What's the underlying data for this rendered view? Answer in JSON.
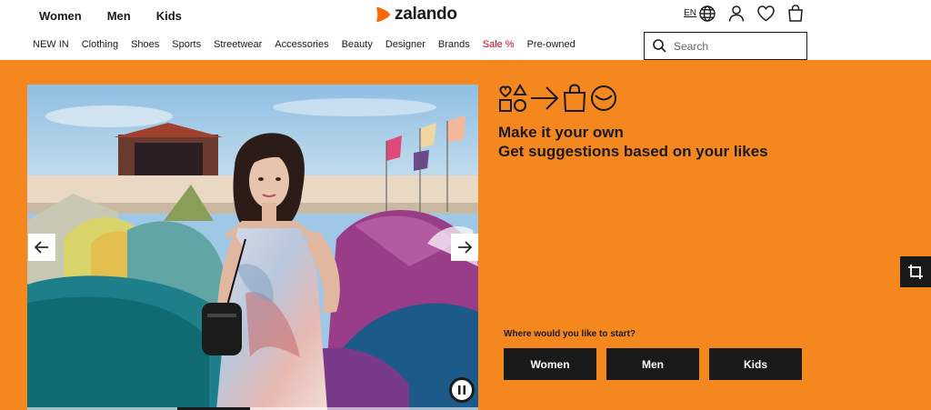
{
  "header": {
    "gender_nav": [
      "Women",
      "Men",
      "Kids"
    ],
    "logo_text": "zalando",
    "language": "EN",
    "icons": [
      "globe-icon",
      "user-icon",
      "heart-icon",
      "bag-icon"
    ],
    "category_nav": [
      "NEW IN",
      "Clothing",
      "Shoes",
      "Sports",
      "Streetwear",
      "Accessories",
      "Beauty",
      "Designer",
      "Brands",
      "Sale %",
      "Pre-owned"
    ],
    "search_placeholder": "Search"
  },
  "hero": {
    "background": "#f5871f",
    "promo_icons": [
      "shapes-icon",
      "arrow-right-icon",
      "shopping-bag-icon",
      "smile-icon"
    ],
    "promo_line_1": "Make it your own",
    "promo_line_2": "Get suggestions based on your likes",
    "start_label": "Where would you like to start?",
    "start_buttons": [
      "Women",
      "Men",
      "Kids"
    ]
  },
  "colors": {
    "brand_orange": "#ff6900",
    "hero_orange": "#f5871f",
    "sale_red": "#d0021b",
    "text_dark": "#1a1a1a"
  }
}
